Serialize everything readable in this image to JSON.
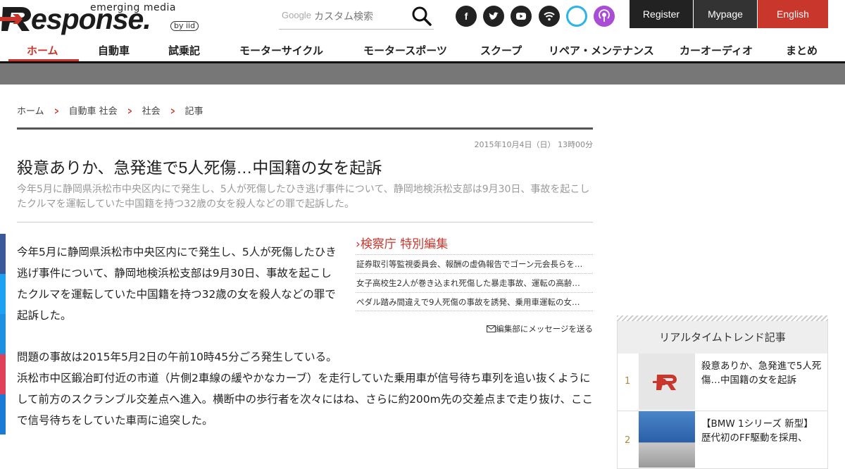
{
  "header": {
    "logo_tagline": "emerging media",
    "logo_word": "esponse.",
    "logo_by": "by iid",
    "search_engine_label": "Google",
    "search_placeholder": "カスタム検索",
    "social_icons": [
      "facebook-icon",
      "twitter-icon",
      "youtube-icon",
      "rss-icon",
      "alexa-icon",
      "podcast-icon"
    ],
    "register_label": "Register",
    "mypage_label": "Mypage",
    "english_label": "English",
    "accent_color": "#c9362c"
  },
  "nav": {
    "items": [
      "ホーム",
      "自動車",
      "試乗記",
      "モーターサイクル",
      "モータースポーツ",
      "スクープ",
      "リペア・メンテナンス",
      "カーオーディオ",
      "まとめ"
    ],
    "active_index": 0
  },
  "breadcrumb": [
    "ホーム",
    "自動車 社会",
    "社会",
    "記事"
  ],
  "article": {
    "date": "2015年10月4日（日） 13時00分",
    "title": "殺意ありか、急発進で5人死傷…中国籍の女を起訴",
    "lead": "今年5月に静岡県浜松市中央区内にで発生し、5人が死傷したひき逃げ事件について、静岡地検浜松支部は9月30日、事故を起こしたクルマを運転していた中国籍を持つ32歳の女を殺人などの罪で起訴した。",
    "body_para1": "今年5月に静岡県浜松市中央区内にで発生し、5人が死傷したひき逃げ事件について、静岡地検浜松支部は9月30日、事故を起こしたクルマを運転していた中国籍を持つ32歳の女を殺人などの罪で起訴した。",
    "body_para2_line1": "問題の事故は2015年5月2日の午前10時45分ごろ発生している。",
    "body_para2_line2": "浜松市中区鍛冶町付近の市道（片側2車線の緩やかなカーブ）を走行していた乗用車が信号待ち車列を追い抜くようにして前方のスクランブル交差点へ進入。横断中の歩行者を次々にはね、さらに約200m先の交差点まで走り抜け、ここで信号待ちをしていた車両に追突した。",
    "mail_label": "編集部にメッセージを送る"
  },
  "related": {
    "heading": "検察庁 特別編集",
    "items": [
      "証券取引等監視委員会、報酬の虚偽報告でゴーン元会長らを…",
      "女子高校生2人が巻き込まれ死傷した暴走事故、運転の高齢…",
      "ペダル踏み間違えで9人死傷の事故を誘発、乗用車運転の女…"
    ]
  },
  "trend": {
    "heading": "リアルタイムトレンド記事",
    "items": [
      {
        "rank": "1",
        "title": "殺意ありか、急発進で5人死傷…中国籍の女を起訴"
      },
      {
        "rank": "2",
        "title": "【BMW 1シリーズ 新型】歴代初のFF駆動を採用、"
      }
    ]
  }
}
